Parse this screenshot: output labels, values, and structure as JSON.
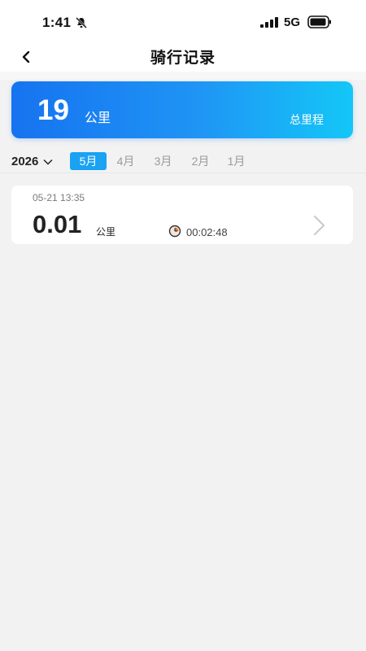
{
  "status_bar": {
    "time": "1:41",
    "network": "5G",
    "icons": [
      "bell-muted-icon",
      "signal-icon",
      "battery-icon"
    ]
  },
  "nav": {
    "title": "骑行记录",
    "back_icon": "chevron-left-icon"
  },
  "summary": {
    "value": "19",
    "unit": "公里",
    "label": "总里程",
    "gradient_colors": [
      "#1673f0",
      "#14c7f7"
    ]
  },
  "filter": {
    "year": "2026",
    "months": [
      "5月",
      "4月",
      "3月",
      "2月",
      "1月"
    ],
    "active_month": "5月",
    "active_color": "#1aa2f3"
  },
  "records": [
    {
      "datetime": "05-21 13:35",
      "distance": "0.01",
      "unit": "公里",
      "duration": "00:02:48"
    }
  ]
}
